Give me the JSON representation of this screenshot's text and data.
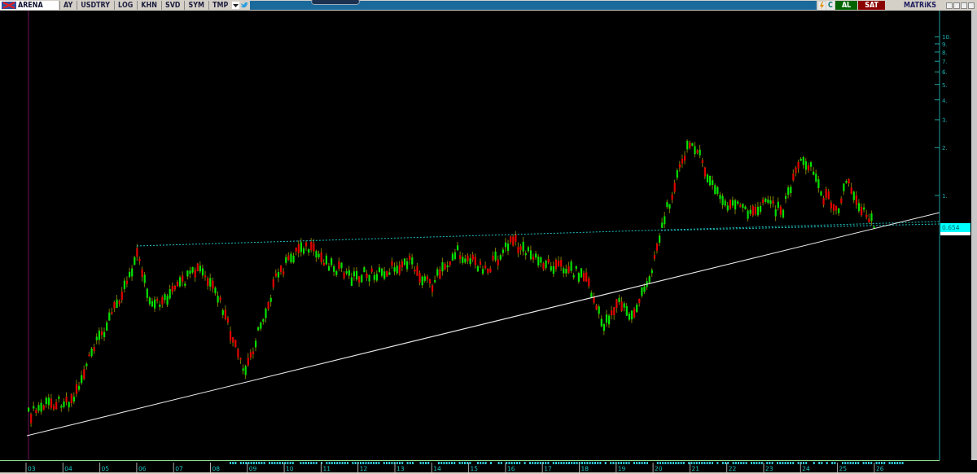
{
  "toolbar": {
    "symbol": "ARENA",
    "buttons": [
      "AY",
      "USDTRY",
      "LOG",
      "KHN",
      "SVD",
      "SYM",
      "TMP"
    ]
  },
  "trade_buttons": [
    {
      "label": "C",
      "kind": "refresh"
    },
    {
      "label": "AL",
      "kind": "buy"
    },
    {
      "label": "SAT",
      "kind": "sell"
    }
  ],
  "brand": "MATRiKS",
  "chart": {
    "price_axis": [
      "10.",
      "9.",
      "8.",
      "7.",
      "6.",
      "5.",
      "4.",
      "3.",
      "2.",
      "1."
    ],
    "last_price": "0.654",
    "years": [
      "03",
      "04",
      "05",
      "06",
      "07",
      "08",
      "09",
      "10",
      "11",
      "12",
      "13",
      "14",
      "15",
      "16",
      "17",
      "18",
      "19",
      "20",
      "21",
      "22",
      "23",
      "24",
      "25",
      "26"
    ]
  }
}
